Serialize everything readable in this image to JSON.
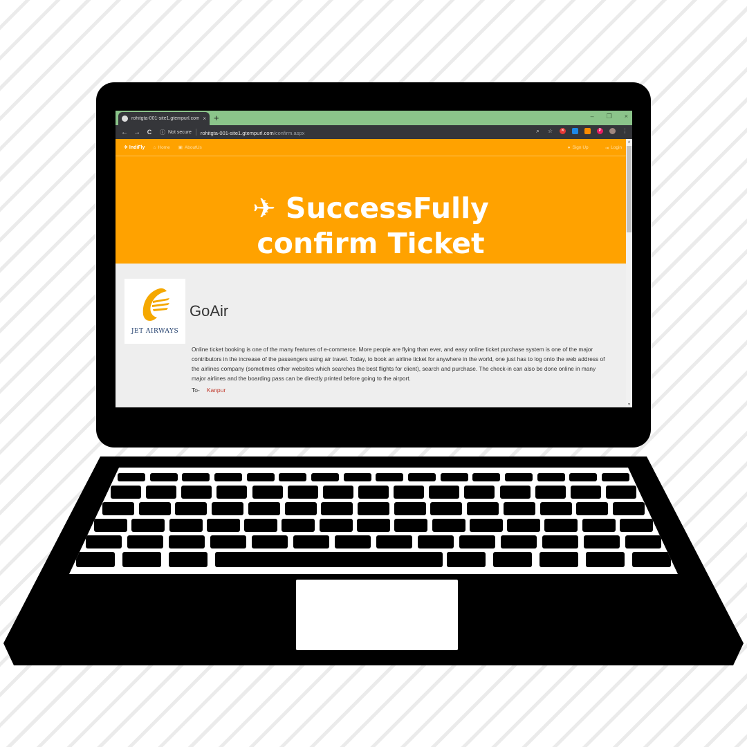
{
  "browser": {
    "tab_title": "rohitgta-001-site1.gtempurl.com",
    "tab_close": "×",
    "new_tab": "+",
    "window_controls": [
      "–",
      "❐",
      "×"
    ],
    "nav": {
      "back": "←",
      "forward": "→",
      "reload": "C"
    },
    "security_label": "Not secure",
    "url_host": "rohitgta-001-site1.gtempurl.com",
    "url_path": "/confirm.aspx"
  },
  "site_nav": {
    "brand": "IndiFly",
    "links": [
      {
        "label": "Home",
        "icon": "home-icon"
      },
      {
        "label": "AboutUs",
        "icon": "document-icon"
      }
    ],
    "right_links": [
      {
        "label": "Sign Up",
        "icon": "user-icon"
      },
      {
        "label": "Login",
        "icon": "login-icon"
      }
    ]
  },
  "hero": {
    "title": "SuccessFully confirm Ticket"
  },
  "ticket": {
    "logo_text": "JET AIRWAYS",
    "airline_name": "GoAir",
    "description": "Online ticket booking is one of the many features of e-commerce. More people are flying than ever, and easy online ticket purchase system is one of the major contributors in the increase of the passengers using air travel. Today, to book an airline ticket for anywhere in the world, one just has to log onto the web address of the airlines company (sometimes other websites which searches the best flights for client), search and purchase. The check-in can also be done online in many major airlines and the boarding pass can be directly printed before going to the airport.",
    "to_label": "To-",
    "destination": "Kanpur"
  },
  "colors": {
    "brand_orange": "#ffa200",
    "tab_bar_green": "#8bc48a",
    "browser_dark": "#35363a",
    "logo_yellow": "#f5a800",
    "logo_navy": "#1d3b6a"
  }
}
